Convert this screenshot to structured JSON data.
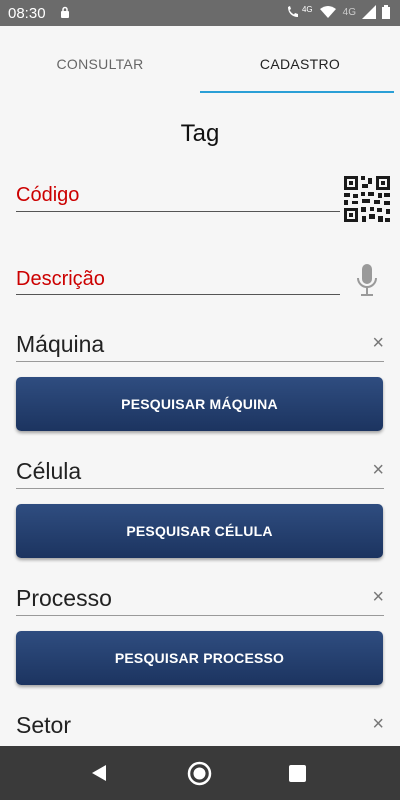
{
  "status_bar": {
    "time": "08:30",
    "network_label_1": "4G",
    "network_label_2": "4G"
  },
  "tabs": [
    {
      "label": "CONSULTAR"
    },
    {
      "label": "CADASTRO"
    }
  ],
  "form": {
    "title": "Tag",
    "codigo_label": "Código",
    "descricao_label": "Descrição",
    "maquina_label": "Máquina",
    "maquina_button": "PESQUISAR MÁQUINA",
    "celula_label": "Célula",
    "celula_button": "PESQUISAR CÉLULA",
    "processo_label": "Processo",
    "processo_button": "PESQUISAR PROCESSO",
    "setor_label": "Setor",
    "clear_symbol": "×"
  },
  "icons": {
    "qr": "qr-code-icon",
    "mic": "microphone-icon",
    "clear": "close-icon",
    "nav_back": "back-triangle-icon",
    "nav_home": "home-circle-icon",
    "nav_recent": "recent-apps-square-icon"
  },
  "colors": {
    "accent": "#2a9fd6",
    "label_red": "#cc0000",
    "button": "#1f3a6b"
  }
}
